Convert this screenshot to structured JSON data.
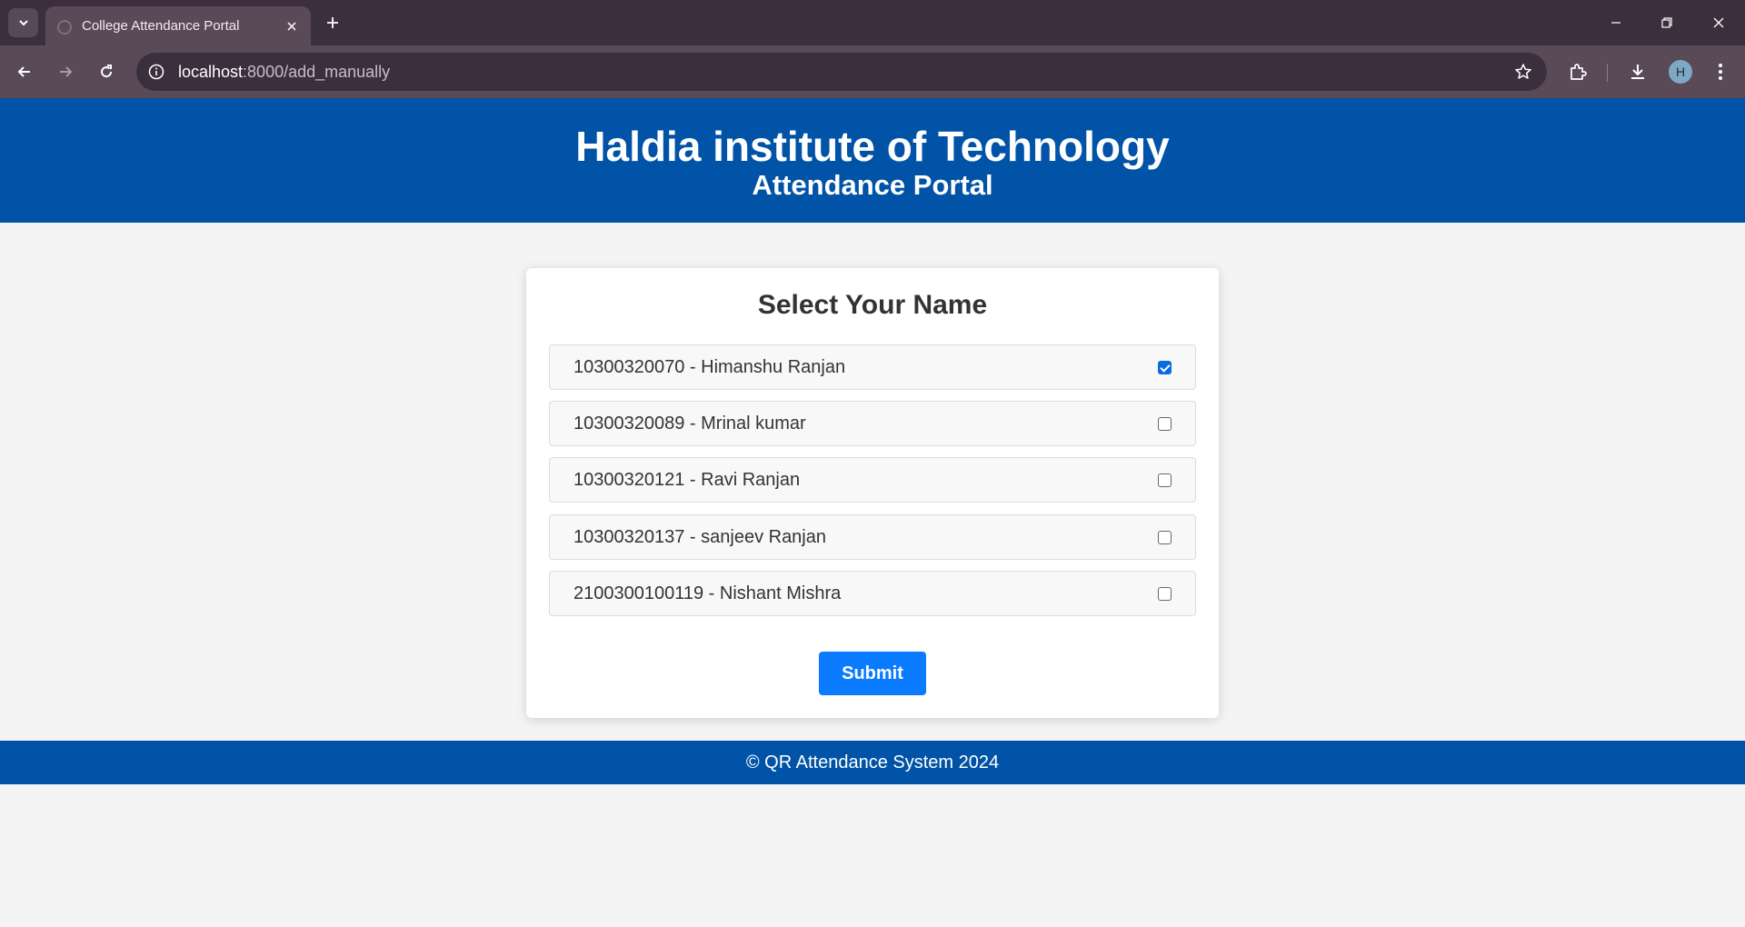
{
  "browser": {
    "tab_title": "College Attendance Portal",
    "url_host": "localhost",
    "url_path": ":8000/add_manually",
    "profile_initial": "H"
  },
  "header": {
    "title": "Haldia institute of Technology",
    "subtitle": "Attendance Portal"
  },
  "form": {
    "title": "Select Your Name",
    "students": [
      {
        "label": "10300320070 - Himanshu Ranjan",
        "checked": true
      },
      {
        "label": "10300320089 - Mrinal kumar",
        "checked": false
      },
      {
        "label": "10300320121 - Ravi Ranjan",
        "checked": false
      },
      {
        "label": "10300320137 - sanjeev Ranjan",
        "checked": false
      },
      {
        "label": "2100300100119 - Nishant Mishra",
        "checked": false
      }
    ],
    "submit_label": "Submit"
  },
  "footer": {
    "text": "© QR Attendance System 2024"
  },
  "colors": {
    "brand": "#0053a6",
    "accent": "#0a7bff"
  }
}
